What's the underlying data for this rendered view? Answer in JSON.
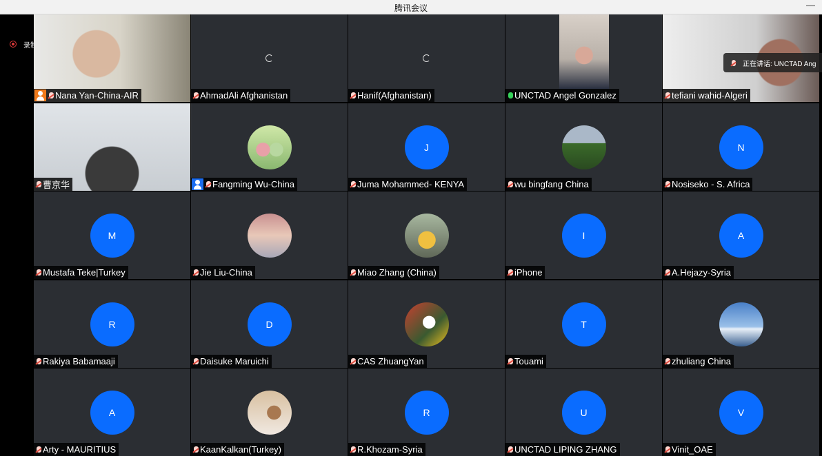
{
  "window": {
    "title": "腾讯会议",
    "minimize_glyph": "—"
  },
  "recording": {
    "label": "录制中",
    "color": "#e23a3a"
  },
  "speaker_overlay": {
    "text": "正在讲话: UNCTAD Ang"
  },
  "participants": [
    {
      "name": "Nana Yan-China-AIR",
      "display": "video",
      "host": true,
      "mic": "muted"
    },
    {
      "name": "AhmadAli Afghanistan",
      "display": "loading",
      "mic": "muted"
    },
    {
      "name": "Hanif(Afghanistan)",
      "display": "loading",
      "mic": "muted"
    },
    {
      "name": "UNCTAD Angel Gonzalez",
      "display": "video",
      "mic": "active",
      "speaking": true
    },
    {
      "name": "tefiani wahid-Algeri",
      "display": "video",
      "mic": "muted"
    },
    {
      "name": "曹京华",
      "display": "video",
      "mic": "muted"
    },
    {
      "name": "Fangming Wu-China",
      "display": "avatar-image",
      "cohost": true,
      "mic": "muted"
    },
    {
      "name": "Juma Mohammed- KENYA",
      "display": "avatar",
      "initial": "J",
      "mic": "muted"
    },
    {
      "name": "wu bingfang China",
      "display": "avatar-image",
      "mic": "muted"
    },
    {
      "name": "Nosiseko - S. Africa",
      "display": "avatar",
      "initial": "N",
      "mic": "muted"
    },
    {
      "name": "Mustafa Teke|Turkey",
      "display": "avatar",
      "initial": "M",
      "mic": "muted"
    },
    {
      "name": "Jie Liu-China",
      "display": "avatar-image",
      "mic": "muted"
    },
    {
      "name": "Miao Zhang (China)",
      "display": "avatar-image",
      "mic": "muted"
    },
    {
      "name": "iPhone",
      "display": "avatar",
      "initial": "I",
      "mic": "muted"
    },
    {
      "name": "A.Hejazy-Syria",
      "display": "avatar",
      "initial": "A",
      "mic": "muted"
    },
    {
      "name": "Rakiya Babamaaji",
      "display": "avatar",
      "initial": "R",
      "mic": "muted"
    },
    {
      "name": "Daisuke Maruichi",
      "display": "avatar",
      "initial": "D",
      "mic": "muted"
    },
    {
      "name": "CAS ZhuangYan",
      "display": "avatar-image",
      "mic": "muted"
    },
    {
      "name": "Touami",
      "display": "avatar",
      "initial": "T",
      "mic": "muted"
    },
    {
      "name": "zhuliang China",
      "display": "avatar-image",
      "mic": "muted"
    },
    {
      "name": "Arty - MAURITIUS",
      "display": "avatar",
      "initial": "A",
      "mic": "muted"
    },
    {
      "name": "KaanKalkan(Turkey)",
      "display": "avatar-image",
      "mic": "muted"
    },
    {
      "name": "R.Khozam-Syria",
      "display": "avatar",
      "initial": "R",
      "mic": "muted"
    },
    {
      "name": "UNCTAD LIPING ZHANG",
      "display": "avatar",
      "initial": "U",
      "mic": "muted"
    },
    {
      "name": "Vinit_OAE",
      "display": "avatar",
      "initial": "V",
      "mic": "muted"
    }
  ],
  "colors": {
    "tile_bg": "#2b2e33",
    "avatar_blue": "#0a6cff",
    "speaking_border": "#1fae3a",
    "host_badge": "#f07a1a",
    "cohost_badge": "#1a6cf0"
  }
}
